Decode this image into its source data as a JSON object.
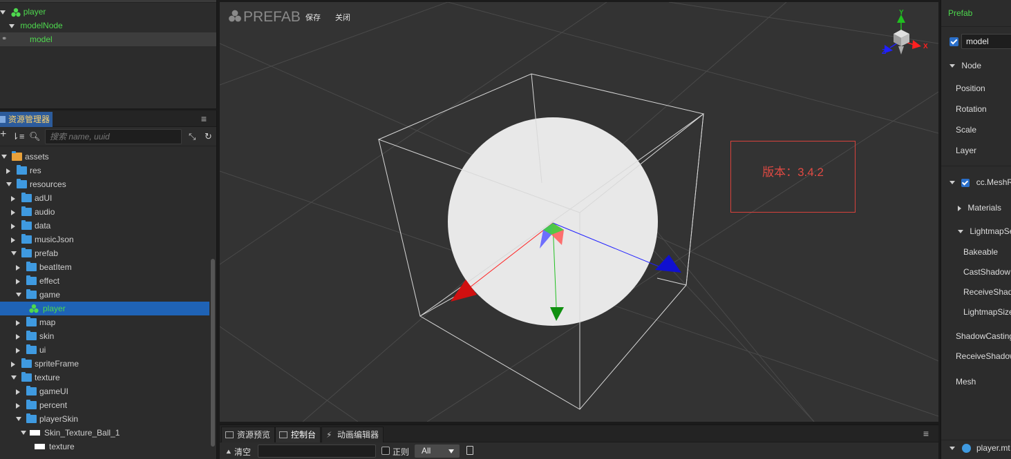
{
  "hierarchy": {
    "items": [
      {
        "label": "player"
      },
      {
        "label": "modelNode"
      },
      {
        "label": "model"
      }
    ]
  },
  "assets": {
    "tab_label": "资源管理器",
    "menu_icon": "≡",
    "search_placeholder": "搜索 name, uuid",
    "tree": [
      {
        "label": "assets"
      },
      {
        "label": "res"
      },
      {
        "label": "resources"
      },
      {
        "label": "adUI"
      },
      {
        "label": "audio"
      },
      {
        "label": "data"
      },
      {
        "label": "musicJson"
      },
      {
        "label": "prefab"
      },
      {
        "label": "beatItem"
      },
      {
        "label": "effect"
      },
      {
        "label": "game"
      },
      {
        "label": "player"
      },
      {
        "label": "map"
      },
      {
        "label": "skin"
      },
      {
        "label": "ui"
      },
      {
        "label": "spriteFrame"
      },
      {
        "label": "texture"
      },
      {
        "label": "gameUI"
      },
      {
        "label": "percent"
      },
      {
        "label": "playerSkin"
      },
      {
        "label": "Skin_Texture_Ball_1"
      },
      {
        "label": "texture"
      }
    ]
  },
  "scene": {
    "title": "PREFAB",
    "save_label": "保存",
    "close_label": "关闭",
    "version_text": "版本：3.4.2",
    "gizmo": {
      "x": "X",
      "y": "Y",
      "z": "Z"
    },
    "colors": {
      "x_axis": "#ff2020",
      "y_axis": "#20c020",
      "z_axis": "#2020ff",
      "version": "#e04a43"
    }
  },
  "console": {
    "tabs": [
      {
        "label": "资源预览"
      },
      {
        "label": "控制台"
      },
      {
        "label": "动画编辑器"
      }
    ],
    "clear_label": "清空",
    "regex_label": "正则",
    "level_value": "All"
  },
  "inspector": {
    "title": "Prefab",
    "node_name": "model",
    "node_section": "Node",
    "props": [
      "Position",
      "Rotation",
      "Scale",
      "Layer"
    ],
    "component": "cc.MeshR",
    "materials": "Materials",
    "lightmap": "LightmapSe",
    "lightmap_props": [
      "Bakeable",
      "CastShadow",
      "ReceiveShad",
      "LightmapSize"
    ],
    "shadow_casting": "ShadowCasting",
    "receive_shadow": "ReceiveShadow",
    "mesh": "Mesh",
    "material_file": "player.mt"
  }
}
